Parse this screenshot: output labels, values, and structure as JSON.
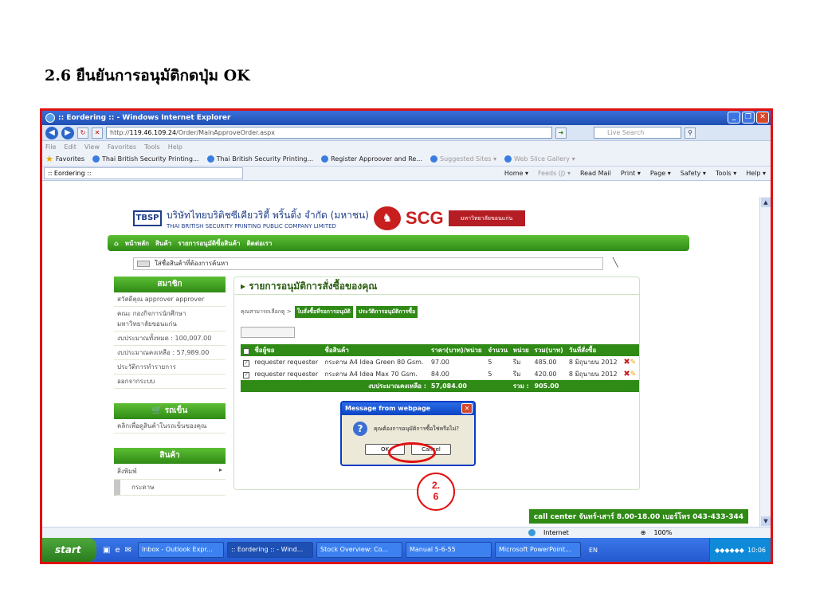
{
  "heading": "2.6 ยืนยันการอนุมัติกดปุ่ม OK",
  "window": {
    "title": ":: Eordering :: - Windows Internet Explorer",
    "url_prefix": "http://",
    "url_host": "119.46.109.24",
    "url_path": "/Order/MainApproveOrder.aspx",
    "search_placeholder": "Live Search",
    "menu": [
      "File",
      "Edit",
      "View",
      "Favorites",
      "Tools",
      "Help"
    ],
    "favorites_label": "Favorites",
    "favorites": [
      "Thai British Security Printing...",
      "Thai British Security Printing...",
      "Register Approover and Re...",
      "Suggested Sites ▾",
      "Web Slice Gallery ▾"
    ],
    "tab_title": ":: Eordering ::",
    "commands": [
      "Home ▾",
      "Feeds (J) ▾",
      "Read Mail",
      "Print ▾",
      "Page ▾",
      "Safety ▾",
      "Tools ▾",
      "Help ▾"
    ]
  },
  "site": {
    "company_th": "บริษัทไทยบริติชซีเคียวริตี้ พริ้นติ้ง จำกัด (มหาชน)",
    "company_en": "THAI BRITISH SECURITY PRINTING PUBLIC COMPANY LIMITED",
    "tbsp": "TBSP",
    "scg": "SCG",
    "university_logo": "มหาวิทยาลัยขอนแก่น",
    "nav": [
      "หน้าหลัก",
      "สินค้า",
      "รายการอนุมัติซื้อสินค้า",
      "ติดต่อเรา"
    ],
    "search_placeholder": "ใส่ชื่อสินค้าที่ต้องการค้นหา"
  },
  "sidebar": {
    "member_title": "สมาชิก",
    "member_items": [
      "สวัสดีคุณ approver approver",
      "คณะ กองกิจการนักศึกษา มหาวิทยาลัยขอนแก่น",
      "งบประมาณทั้งหมด : 100,007.00",
      "งบประมาณคงเหลือ : 57,989.00",
      "ประวัติการทำรายการ",
      "ออกจากระบบ"
    ],
    "cart_title": "รถเข็น",
    "cart_item": "คลิกเพื่อดูสินค้าในรถเข็นของคุณ",
    "product_title": "สินค้า",
    "product_items": [
      "สิ่งพิมพ์",
      "กระดาษ"
    ]
  },
  "panel": {
    "title": "รายการอนุมัติการสั่งซื้อของคุณ",
    "choose_label": "คุณสามารถเลือกดู >",
    "chip_pending": "ใบสั่งซื้อที่รอการอนุมัติ",
    "chip_history": "ประวัติการอนุมัติการซื้อ",
    "columns": [
      "ชื่อผู้ขอ",
      "ชื่อสินค้า",
      "ราคา(บาท)/หน่วย",
      "จำนวน",
      "หน่วย",
      "รวม(บาท)",
      "วันที่สั่งซื้อ"
    ],
    "rows": [
      {
        "requester": "requester requester",
        "product": "กระดาษ A4 Idea Green 80 Gsm.",
        "price": "97.00",
        "qty": "5",
        "unit": "รีม",
        "total": "485.00",
        "date": "8 มิถุนายน 2012"
      },
      {
        "requester": "requester requester",
        "product": "กระดาษ A4 Idea Max 70 Gsm.",
        "price": "84.00",
        "qty": "5",
        "unit": "รีม",
        "total": "420.00",
        "date": "8 มิถุนายน 2012"
      }
    ],
    "budget_left_label": "งบประมาณคงเหลือ :",
    "budget_left_value": "57,084.00",
    "sum_label": "รวม :",
    "sum_value": "905.00",
    "call_center": "call center จันทร์-เสาร์ 8.00-18.00 เบอร์โทร 043-433-344"
  },
  "dialog": {
    "title": "Message from webpage",
    "message": "คุณต้องการอนุมัติการซื้อใช่หรือไม่?",
    "ok_label": "OK",
    "cancel_label": "Cancel"
  },
  "step_label_top": "2.",
  "step_label_bottom": "6",
  "status": {
    "zone": "Internet",
    "zoom": "100%"
  },
  "taskbar": {
    "start_label": "start",
    "tasks": [
      "Inbox - Outlook Expr...",
      ":: Eordering :: - Wind...",
      "Stock Overview: Co...",
      "Manual 5-6-55",
      "Microsoft PowerPoint..."
    ],
    "lang": "EN",
    "clock": "10:06"
  }
}
